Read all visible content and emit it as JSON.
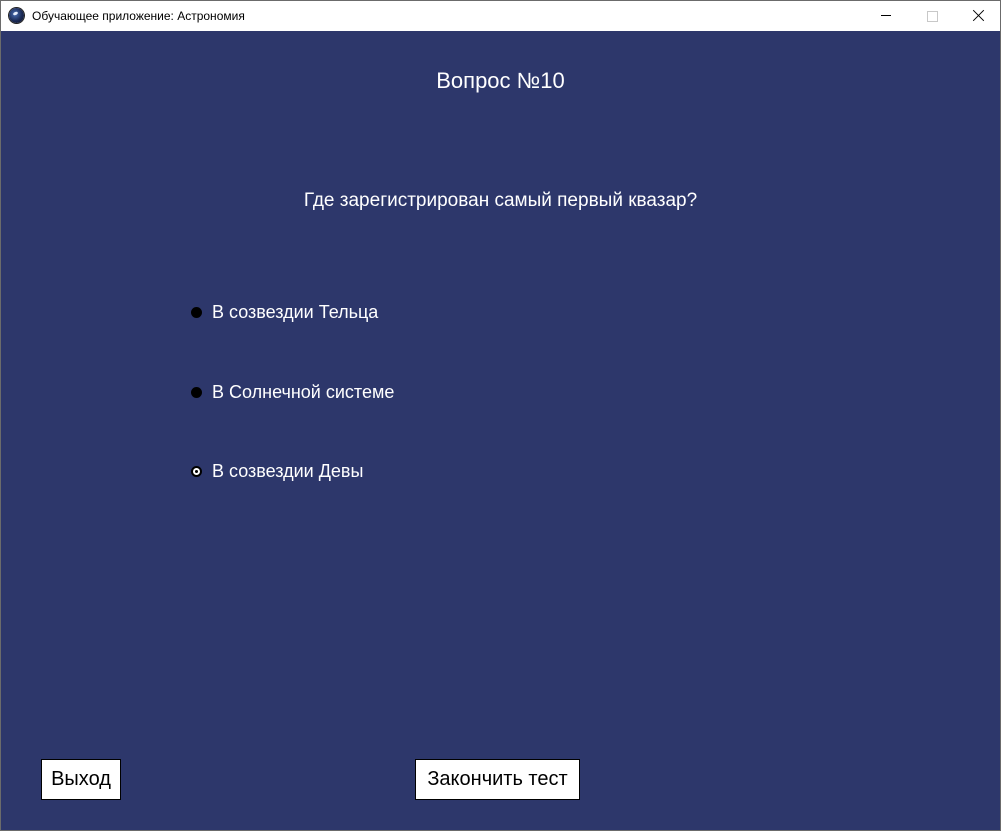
{
  "window": {
    "title": "Обучающее приложение: Астрономия",
    "background_color": "#2d376b",
    "icons": {
      "app": "planet-icon",
      "minimize": "minimize-icon",
      "maximize": "maximize-icon",
      "close": "close-icon"
    }
  },
  "quiz": {
    "question_number": "Вопрос №10",
    "question_text": "Где зарегистрирован самый первый квазар?",
    "options": [
      {
        "label": "В созвездии Тельца",
        "selected": false
      },
      {
        "label": "В Солнечной системе",
        "selected": false
      },
      {
        "label": "В созвездии Девы",
        "selected": true
      }
    ]
  },
  "buttons": {
    "exit_label": "Выход",
    "finish_label": "Закончить тест"
  }
}
